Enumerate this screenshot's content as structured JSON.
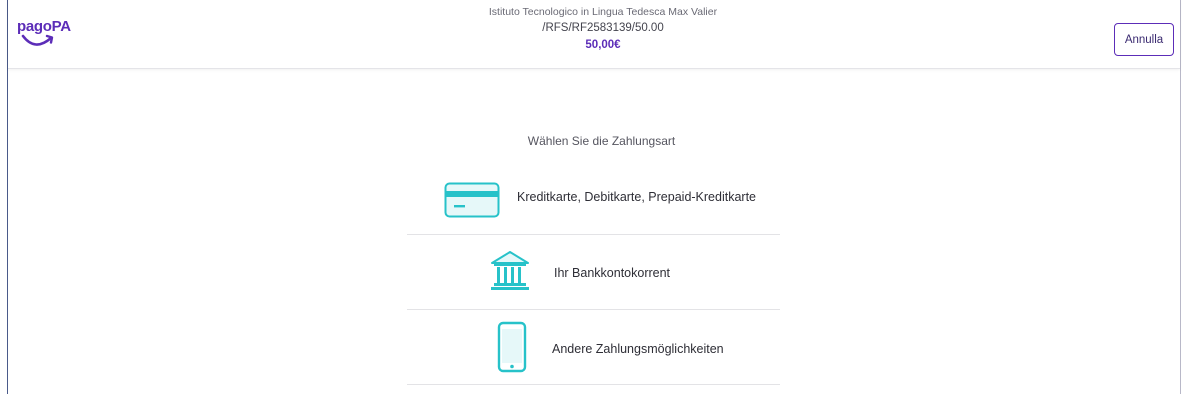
{
  "header": {
    "logo_text": "pagoPA",
    "payee": "Istituto Tecnologico in Lingua Tedesca Max Valier",
    "notice_code": "/RFS/RF2583139/50.00",
    "amount": "50,00€",
    "cancel_label": "Annulla"
  },
  "main": {
    "title": "Wählen Sie die Zahlungsart",
    "methods": [
      {
        "label": "Kreditkarte, Debitkarte, Prepaid-Kreditkarte",
        "icon": "credit-card-icon"
      },
      {
        "label": "Ihr Bankkontokorrent",
        "icon": "bank-icon"
      },
      {
        "label": "Andere Zahlungsmöglichkeiten",
        "icon": "smartphone-icon"
      }
    ]
  },
  "colors": {
    "brand": "#5c2db8",
    "icon_accent": "#27c2c9"
  }
}
